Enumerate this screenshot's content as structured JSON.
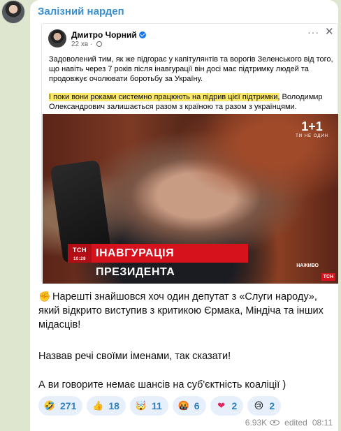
{
  "channel": {
    "name": "Залізний нардеп"
  },
  "post": {
    "author": "Дмитро Чорний",
    "time": "22 хв",
    "more": "···",
    "close": "✕",
    "paragraph1": "Задоволений тим, як же підгорає у капітулянтів та ворогів Зеленського від того, що навіть через 7 років після інавгурації він досі має підтримку людей та продовжує очолювати боротьбу за Україну.",
    "paragraph2_highlight": "І поки вони роками системно працюють на підрив цієї підтримки,",
    "paragraph2_rest": " Володимир Олександрович залишається разом з країною та разом з українцями.",
    "image": {
      "banner_text": "ІНАВГУРАЦІЯ ПРЕЗИДЕНТА",
      "tag_text": "ТСН",
      "tag_time": "10:28",
      "channel_logo": "1+1",
      "channel_sub": "ТИ НЕ ОДИН",
      "live_label": "НАЖИВО",
      "corner_logo": "ТСН"
    }
  },
  "message": {
    "line1": "Нарешті знайшовся хоч один депутат з «Слуги народу», який відкрито виступив з критикою Єрмака, Міндіча та інших мідасців!",
    "line1_emoji": "✊",
    "line2": "Назвав речі своїми іменами, так сказати!",
    "line3": "А ви говорите немає шансів на суб'єктність коаліції )"
  },
  "reactions": [
    {
      "emoji": "🤣",
      "icon": "rofl-icon",
      "count": "271"
    },
    {
      "emoji": "👍",
      "icon": "thumbs-up-icon",
      "count": "18"
    },
    {
      "emoji": "🤯",
      "icon": "mind-blown-icon",
      "count": "11"
    },
    {
      "emoji": "🤬",
      "icon": "angry-icon",
      "count": "6"
    },
    {
      "emoji": "❤",
      "icon": "heart-icon",
      "count": "2"
    },
    {
      "emoji": "😢",
      "icon": "crying-icon",
      "count": "2"
    }
  ],
  "footer": {
    "views": "6.93K",
    "edited": "edited",
    "time": "08:11"
  },
  "colors": {
    "accent": "#3a8fd0",
    "highlight": "#fbe96b",
    "tsn_red": "#d6121c",
    "reaction_bg": "#e7f0fa"
  }
}
